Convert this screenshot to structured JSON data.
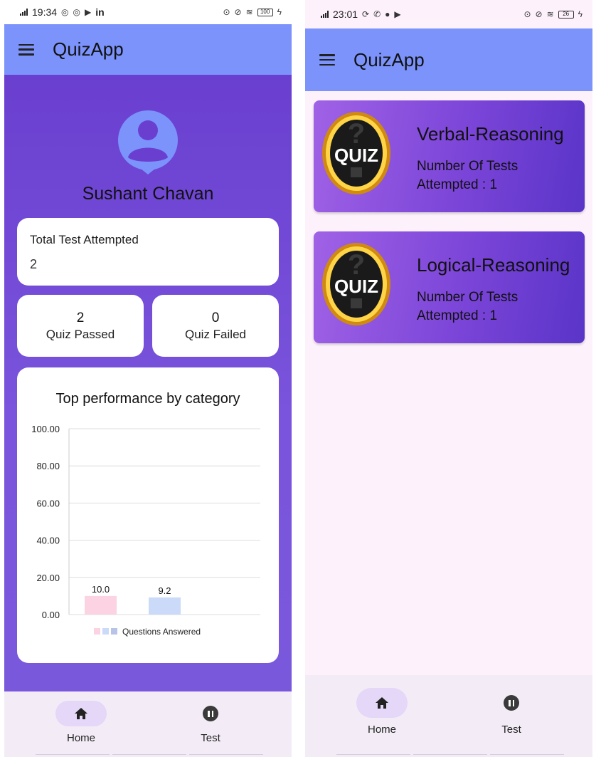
{
  "left_screen": {
    "status_bar": {
      "time": "19:34",
      "extra": "in",
      "battery": "100"
    },
    "app_bar": {
      "title": "QuizApp"
    },
    "profile": {
      "name": "Sushant Chavan"
    },
    "stats": {
      "total_label": "Total Test Attempted",
      "total_value": "2",
      "passed_value": "2",
      "passed_label": "Quiz Passed",
      "failed_value": "0",
      "failed_label": "Quiz Failed"
    },
    "chart_title": "Top performance by category",
    "bottom_nav": [
      {
        "label": "Home",
        "icon": "home-icon",
        "active": true
      },
      {
        "label": "Test",
        "icon": "pause-icon",
        "active": false
      }
    ]
  },
  "chart_data": {
    "type": "bar",
    "title": "Top performance by category",
    "categories": [
      "",
      ""
    ],
    "series": [
      {
        "name": "Questions Answered",
        "values": [
          10.0,
          9.2
        ],
        "data_labels": [
          "10.0",
          "9.2"
        ],
        "colors": [
          "#fbd3e2",
          "#cbdaf8"
        ]
      }
    ],
    "yticks": [
      "0.00",
      "20.00",
      "40.00",
      "60.00",
      "80.00",
      "100.00"
    ],
    "ylim": [
      0,
      100
    ],
    "grid": true,
    "legend_position": "bottom",
    "legend_colors": [
      "#fbd3e2",
      "#cbdaf8",
      "#b7c4e8"
    ]
  },
  "right_screen": {
    "status_bar": {
      "time": "23:01",
      "battery": "26"
    },
    "app_bar": {
      "title": "QuizApp"
    },
    "quiz_logo_text": "QUIZ",
    "categories": [
      {
        "title": "Verbal-Reasoning",
        "subtitle_line1": "Number Of Tests",
        "subtitle_line2": "Attempted : 1"
      },
      {
        "title": "Logical-Reasoning",
        "subtitle_line1": "Number Of Tests",
        "subtitle_line2": "Attempted : 1"
      }
    ],
    "bottom_nav": [
      {
        "label": "Home",
        "icon": "home-icon",
        "active": true
      },
      {
        "label": "Test",
        "icon": "pause-icon",
        "active": false
      }
    ]
  },
  "colors": {
    "app_bar": "#7b93fb",
    "purple": "#6a3fd0",
    "avatar": "#7b93fb",
    "nav_pill": "#e4d7f7"
  }
}
